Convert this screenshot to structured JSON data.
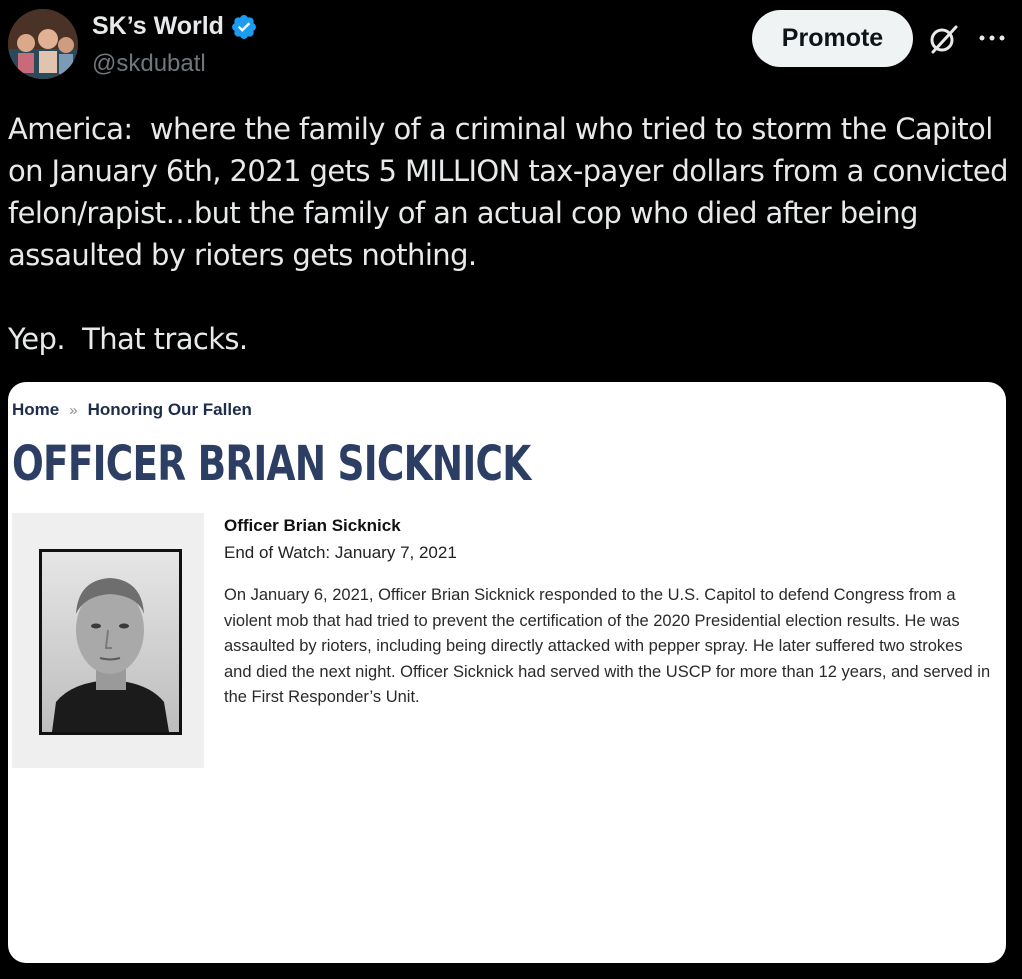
{
  "author": {
    "display_name": "SK’s World",
    "handle": "@skdubatl",
    "verified": true
  },
  "actions": {
    "promote_label": "Promote",
    "icons": [
      "grok-icon",
      "more-icon"
    ]
  },
  "tweet": {
    "text": "America:  where the family of a criminal who tried to storm the Capitol on January 6th, 2021 gets 5 MILLION tax-payer dollars from a convicted felon/rapist…but the family of an actual cop who died after being assaulted by rioters gets nothing.\n\nYep.  That tracks."
  },
  "card": {
    "breadcrumb": {
      "home": "Home",
      "separator": "»",
      "current": "Honoring Our Fallen"
    },
    "title": "OFFICER BRIAN SICKNICK",
    "officer_name": "Officer Brian Sicknick",
    "end_of_watch": "End of Watch: January 7, 2021",
    "bio": "On January 6, 2021, Officer Brian Sicknick responded to the U.S. Capitol to defend Congress from a violent mob that had tried to prevent the certification of the 2020 Presidential election results. He was assaulted by rioters, including being directly attacked with pepper spray. He later suffered two strokes and died the next night. Officer Sicknick had served with the USCP for more than 12 years, and served in the First Responder’s Unit."
  },
  "colors": {
    "background": "#000000",
    "text_primary": "#e7e9ea",
    "text_secondary": "#71767b",
    "verified_blue": "#1d9bf0",
    "title_navy": "#2c3e63"
  }
}
